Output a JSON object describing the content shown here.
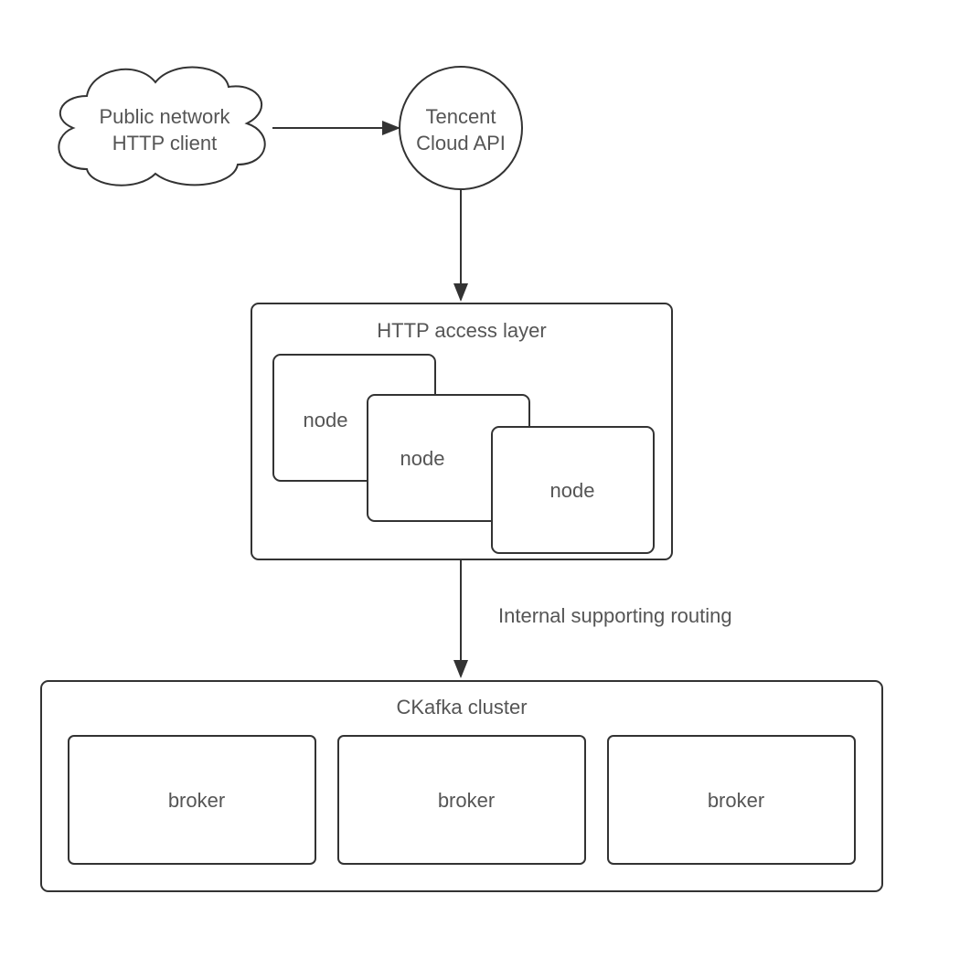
{
  "client": {
    "line1": "Public network",
    "line2": "HTTP client"
  },
  "api": {
    "line1": "Tencent",
    "line2": "Cloud API"
  },
  "access_layer": {
    "title": "HTTP access layer",
    "nodes": [
      "node",
      "node",
      "node"
    ]
  },
  "routing_label": "Internal supporting routing",
  "cluster": {
    "title": "CKafka cluster",
    "brokers": [
      "broker",
      "broker",
      "broker"
    ]
  }
}
